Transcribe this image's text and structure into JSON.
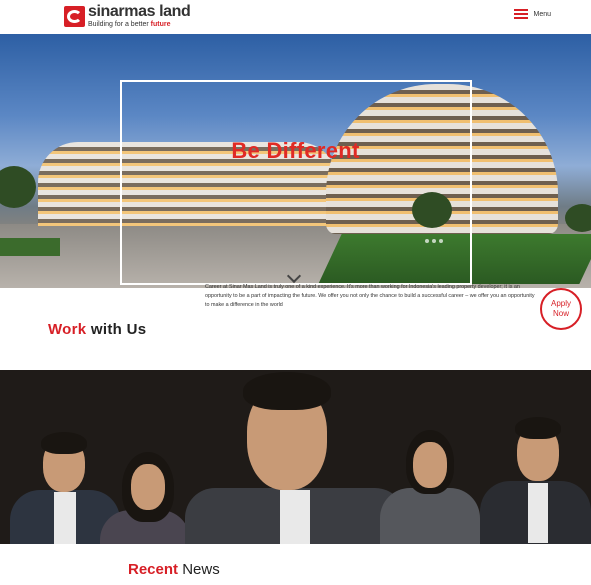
{
  "header": {
    "logo_name": "sinarmas land",
    "logo_tagline_prefix": "Building for a better ",
    "logo_tagline_highlight": "future",
    "menu_label": "Menu"
  },
  "hero": {
    "title": "Be Different"
  },
  "work": {
    "title_highlight": "Work",
    "title_rest": " with Us",
    "description": "Career at Sinar Mas Land is truly one of a kind experience. It's more than working for Indonesia's leading property developer; it is an opportunity to be a part of impacting the future. We offer you not only the chance to build a successful career – we offer you an opportunity to make a difference in the world",
    "apply_line1": "Apply",
    "apply_line2": "Now"
  },
  "recent": {
    "highlight": "Recent",
    "rest": " News"
  },
  "colors": {
    "brand_red": "#d71f26"
  }
}
